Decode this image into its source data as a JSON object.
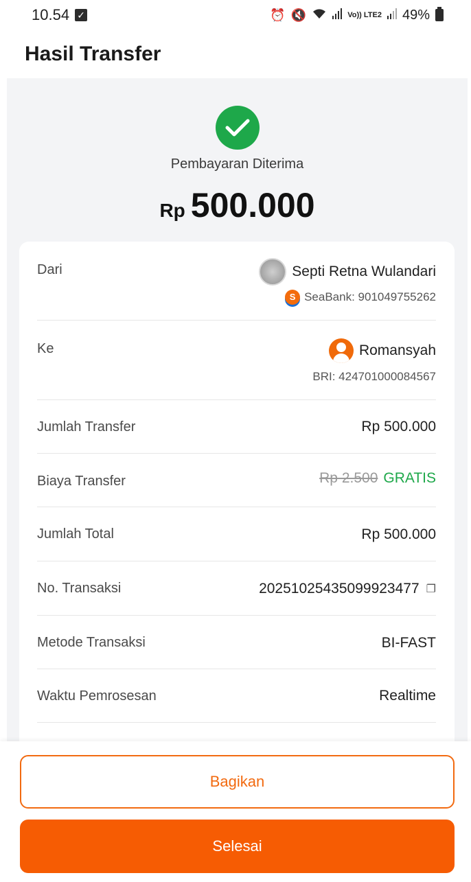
{
  "status_bar": {
    "time": "10.54",
    "battery": "49%",
    "volte_label": "Vo)) LTE2"
  },
  "header": {
    "title": "Hasil Transfer"
  },
  "summary": {
    "status": "Pembayaran Diterima",
    "currency": "Rp",
    "amount": "500.000"
  },
  "details": {
    "from": {
      "label": "Dari",
      "name": "Septi Retna Wulandari",
      "account": "SeaBank: 901049755262"
    },
    "to": {
      "label": "Ke",
      "name": "Romansyah",
      "account": "BRI: 424701000084567"
    },
    "transfer_amount": {
      "label": "Jumlah Transfer",
      "value": "Rp 500.000"
    },
    "fee": {
      "label": "Biaya Transfer",
      "original": "Rp 2.500",
      "free": "GRATIS"
    },
    "total": {
      "label": "Jumlah Total",
      "value": "Rp 500.000"
    },
    "transaction_no": {
      "label": "No. Transaksi",
      "value": "20251025435099923477"
    },
    "method": {
      "label": "Metode Transaksi",
      "value": "BI-FAST"
    },
    "processing": {
      "label": "Waktu Pemrosesan",
      "value": "Realtime"
    }
  },
  "actions": {
    "share": "Bagikan",
    "done": "Selesai"
  },
  "colors": {
    "accent": "#f65c03",
    "success": "#1ea84a"
  }
}
